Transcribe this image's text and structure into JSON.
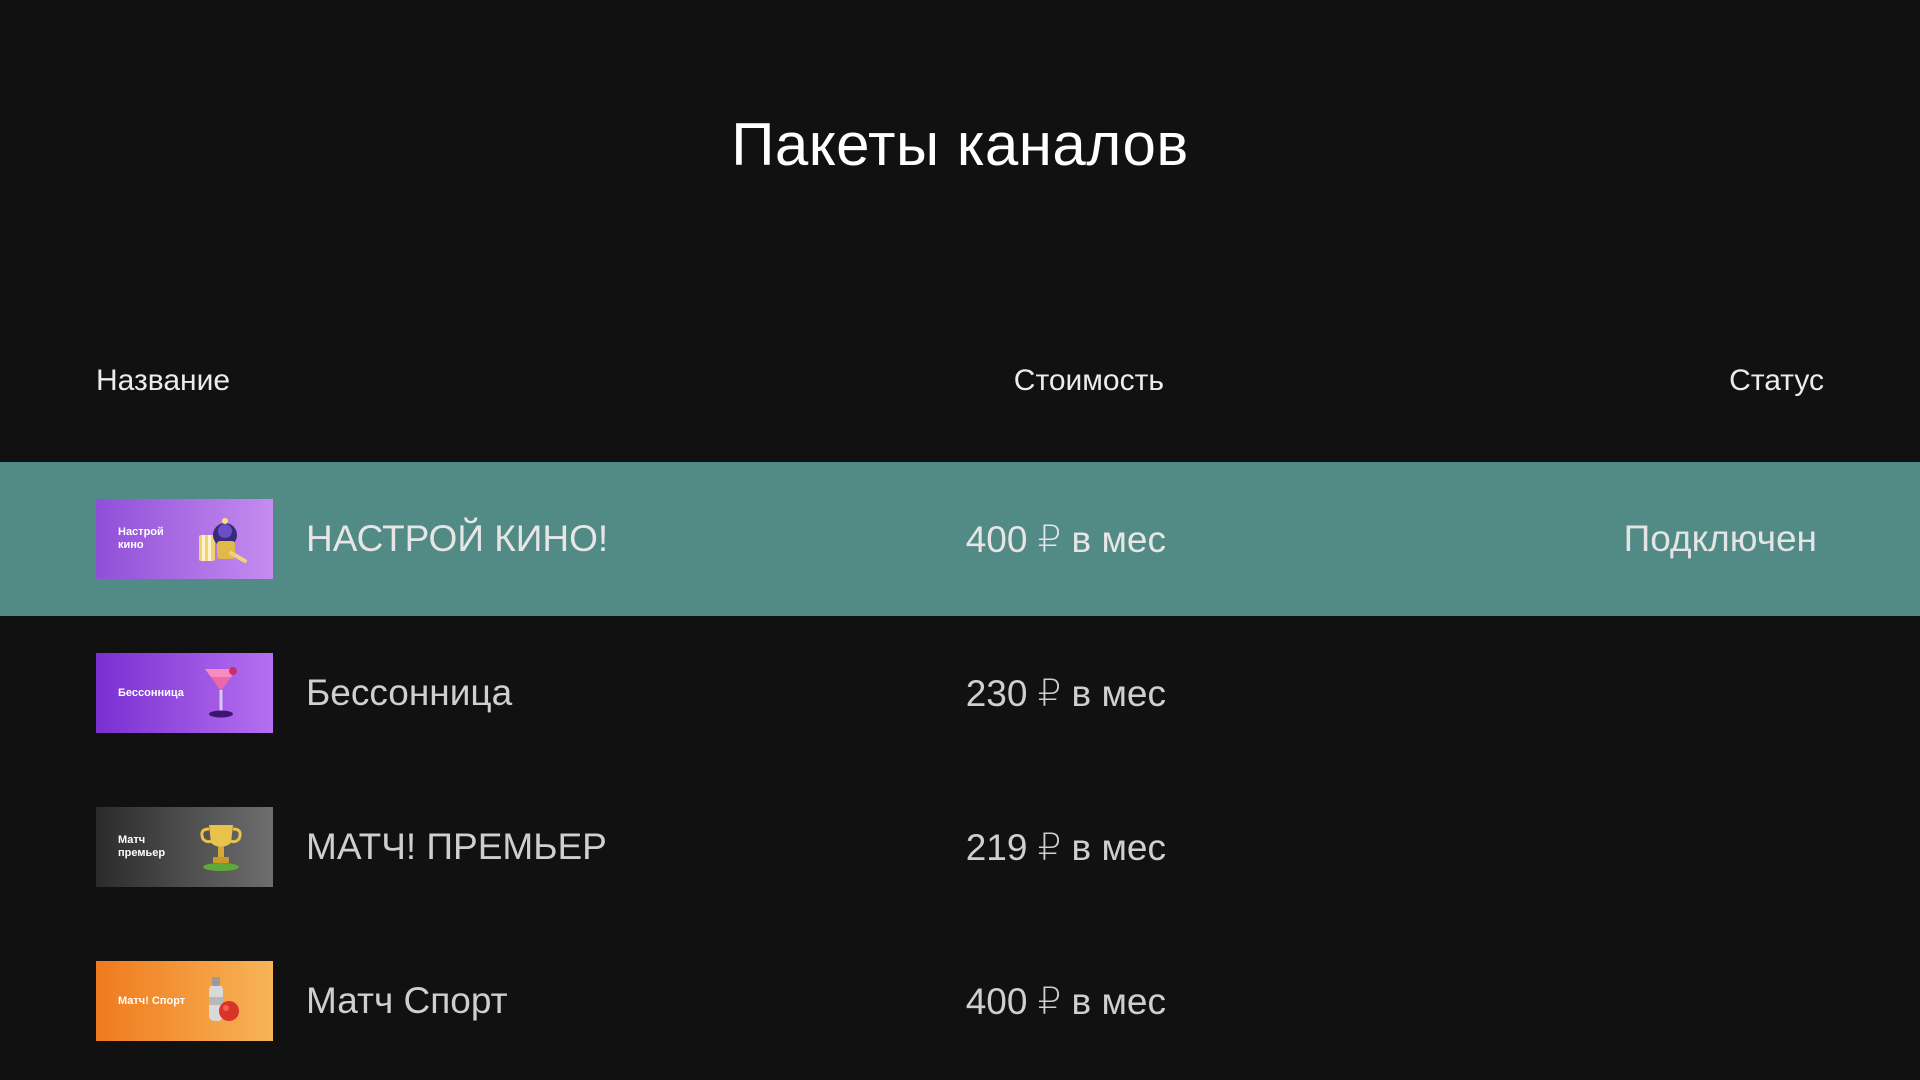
{
  "page": {
    "title": "Пакеты каналов"
  },
  "columns": {
    "name": "Название",
    "cost": "Стоимость",
    "status": "Статус"
  },
  "colors": {
    "background": "#111112",
    "selected_row": "#528a85"
  },
  "packages": [
    {
      "thumb_label": "Настрой\nкино",
      "thumb_icon": "popcorn-icon",
      "thumb_colors": [
        "#8f4fd9",
        "#c58cf0"
      ],
      "name": "НАСТРОЙ КИНО!",
      "price": "400 ₽ в мес",
      "status": "Подключен",
      "selected": true
    },
    {
      "thumb_label": "Бессонница",
      "thumb_icon": "cocktail-icon",
      "thumb_colors": [
        "#7a2fd1",
        "#b56ff0"
      ],
      "name": "Бессонница",
      "price": "230 ₽ в мес",
      "status": "",
      "selected": false
    },
    {
      "thumb_label": "Матч\nпремьер",
      "thumb_icon": "trophy-icon",
      "thumb_colors": [
        "#2b2b2b",
        "#6e6e6e"
      ],
      "name": "МАТЧ! ПРЕМЬЕР",
      "price": "219 ₽ в мес",
      "status": "",
      "selected": false
    },
    {
      "thumb_label": "Матч! Спорт",
      "thumb_icon": "sport-bottle-icon",
      "thumb_colors": [
        "#f07a1e",
        "#f7b457"
      ],
      "name": "Матч Спорт",
      "price": "400 ₽ в мес",
      "status": "",
      "selected": false
    }
  ]
}
